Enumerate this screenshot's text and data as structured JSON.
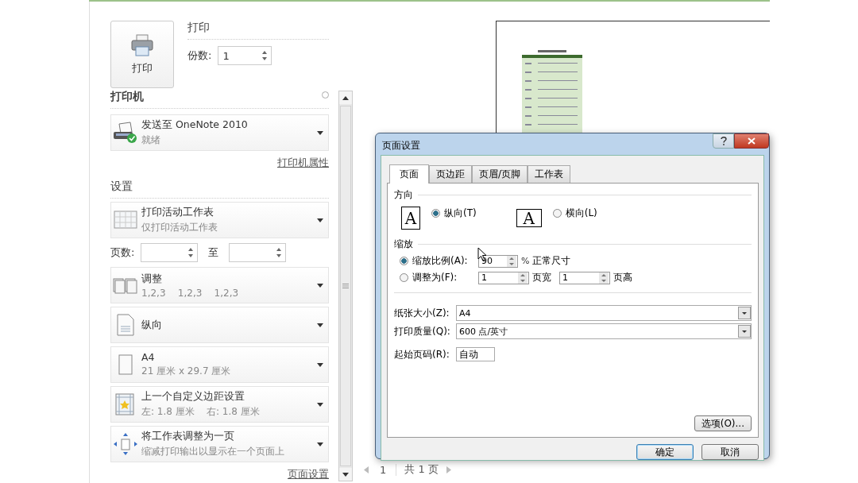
{
  "print_section": {
    "print_button": "打印",
    "heading": "打印",
    "copies_label": "份数:",
    "copies_value": "1"
  },
  "printer": {
    "heading": "打印机",
    "name": "发送至 OneNote 2010",
    "status": "就绪",
    "properties_link": "打印机属性"
  },
  "settings": {
    "heading": "设置",
    "dropdowns": [
      {
        "kind": "sheet",
        "title": "打印活动工作表",
        "subtitle": "仅打印活动工作表"
      },
      {
        "kind": "collate",
        "title": "调整",
        "subtitle": "1,2,3    1,2,3    1,2,3"
      },
      {
        "kind": "portrait",
        "title": "纵向"
      },
      {
        "kind": "paper",
        "title": "A4",
        "subtitle": "21 厘米 x 29.7 厘米"
      },
      {
        "kind": "margins",
        "title": "上一个自定义边距设置",
        "subtitle": "左: 1.8 厘米    右: 1.8 厘米"
      },
      {
        "kind": "fit",
        "title": "将工作表调整为一页",
        "subtitle": "缩减打印输出以显示在一个页面上"
      }
    ],
    "pages_label": "页数:",
    "pages_to": "至",
    "page_setup_link": "页面设置"
  },
  "preview": {
    "page_field": "1",
    "page_count": "共 1 页"
  },
  "dialog": {
    "title": "页面设置",
    "tabs": [
      {
        "label": "页面",
        "selected": true
      },
      {
        "label": "页边距",
        "selected": false
      },
      {
        "label": "页眉/页脚",
        "selected": false
      },
      {
        "label": "工作表",
        "selected": false
      }
    ],
    "orientation": {
      "heading": "方向",
      "options": [
        {
          "kind": "portrait",
          "glyph": "A",
          "label": "纵向(T)",
          "selected": true
        },
        {
          "kind": "landscape",
          "glyph": "A",
          "label": "横向(L)",
          "selected": false
        }
      ]
    },
    "scaling": {
      "heading": "缩放",
      "options": [
        {
          "label": "缩放比例(A):",
          "selected": true
        },
        {
          "label": "调整为(F):",
          "selected": false
        }
      ],
      "percent_value": "90",
      "percent_sign": "%",
      "percent_note": "正常尺寸",
      "wide_value": "1",
      "wide_label": "页宽",
      "tall_value": "1",
      "tall_label": "页高"
    },
    "paper_size": {
      "label": "纸张大小(Z):",
      "value": "A4"
    },
    "print_quality": {
      "label": "打印质量(Q):",
      "value": "600 点/英寸"
    },
    "first_page": {
      "label": "起始页码(R):",
      "value": "自动"
    },
    "options_button": "选项(O)...",
    "ok_button": "确定",
    "cancel_button": "取消"
  }
}
